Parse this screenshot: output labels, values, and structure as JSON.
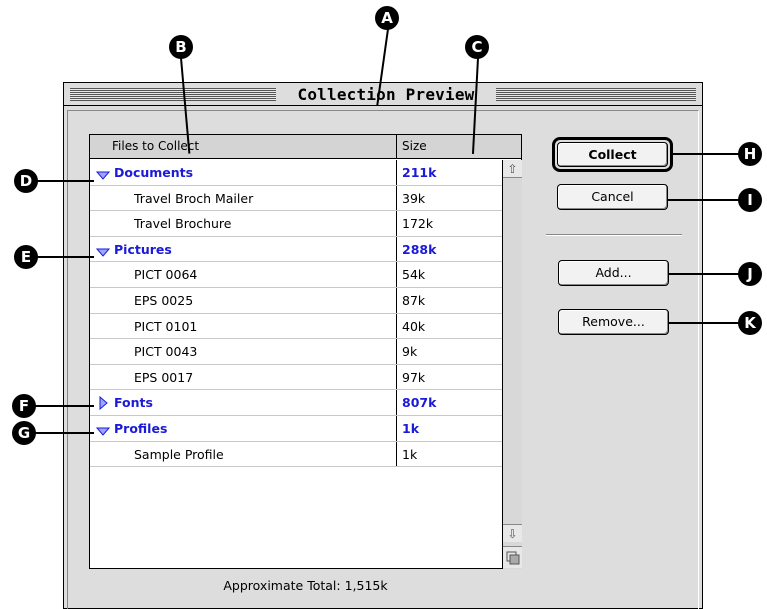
{
  "window": {
    "title": "Collection Preview"
  },
  "list": {
    "col_files": "Files to Collect",
    "col_size": "Size",
    "rows": [
      {
        "name": "Documents",
        "size": "211k",
        "group": true,
        "expanded": true
      },
      {
        "name": "Travel Broch Mailer",
        "size": "39k"
      },
      {
        "name": "Travel Brochure",
        "size": "172k"
      },
      {
        "name": "Pictures",
        "size": "288k",
        "group": true,
        "expanded": true
      },
      {
        "name": "PICT 0064",
        "size": "54k"
      },
      {
        "name": "EPS 0025",
        "size": "87k"
      },
      {
        "name": "PICT 0101",
        "size": "40k"
      },
      {
        "name": "PICT 0043",
        "size": "9k"
      },
      {
        "name": "EPS 0017",
        "size": "97k"
      },
      {
        "name": "Fonts",
        "size": "807k",
        "group": true,
        "expanded": false
      },
      {
        "name": "Profiles",
        "size": "1k",
        "group": true,
        "expanded": true
      },
      {
        "name": "Sample Profile",
        "size": "1k"
      }
    ]
  },
  "total": "Approximate Total: 1,515k",
  "buttons": {
    "collect": "Collect",
    "cancel": "Cancel",
    "add": "Add...",
    "remove": "Remove..."
  },
  "callouts": {
    "a": "A",
    "b": "B",
    "c": "C",
    "d": "D",
    "e": "E",
    "f": "F",
    "g": "G",
    "h": "H",
    "i": "I",
    "j": "J",
    "k": "K"
  },
  "colors": {
    "group_text": "#1a1ad8"
  }
}
